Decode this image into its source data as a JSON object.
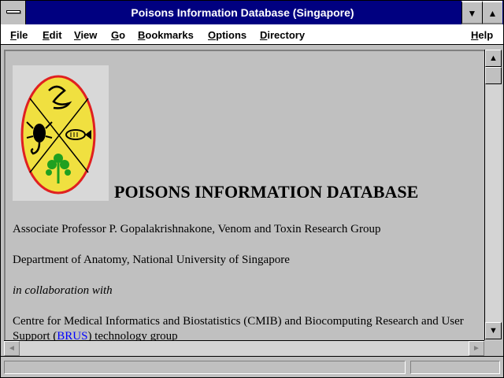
{
  "window": {
    "title": "Poisons Information Database (Singapore)",
    "system_menu_icon": "system-menu-icon",
    "minimize_glyph": "▼",
    "maximize_glyph": "▲"
  },
  "menu": {
    "items": [
      {
        "label": "File",
        "ul": "F",
        "rest": "ile"
      },
      {
        "label": "Edit",
        "ul": "E",
        "rest": "dit"
      },
      {
        "label": "View",
        "ul": "V",
        "rest": "iew"
      },
      {
        "label": "Go",
        "ul": "G",
        "rest": "o"
      },
      {
        "label": "Bookmarks",
        "ul": "B",
        "rest": "ookmarks"
      },
      {
        "label": "Options",
        "ul": "O",
        "rest": "ptions"
      },
      {
        "label": "Directory",
        "ul": "D",
        "rest": "irectory"
      },
      {
        "label": "Help",
        "ul": "H",
        "rest": "elp"
      }
    ]
  },
  "page": {
    "heading": "POISONS INFORMATION DATABASE",
    "author_line": "Associate Professor P. Gopalakrishnakone, Venom and Toxin Research Group",
    "department_line": "Department of Anatomy, National University of Singapore",
    "collab_line": "in collaboration with",
    "centre_line": "Centre for Medical Informatics and Biostatistics (CMIB) and Biocomputing Research and User",
    "support_prefix": "Support (",
    "support_link": "BRUS",
    "support_suffix": ") technology group",
    "logo_icon": "poisons-database-logo",
    "colors": {
      "link": "#0000ff",
      "logo_fill": "#f0e040",
      "logo_border": "#e02020",
      "tree": "#20a020"
    }
  },
  "scrollbars": {
    "up_glyph": "▲",
    "down_glyph": "▼",
    "left_glyph": "◄",
    "right_glyph": "►"
  },
  "status": {
    "text": ""
  }
}
